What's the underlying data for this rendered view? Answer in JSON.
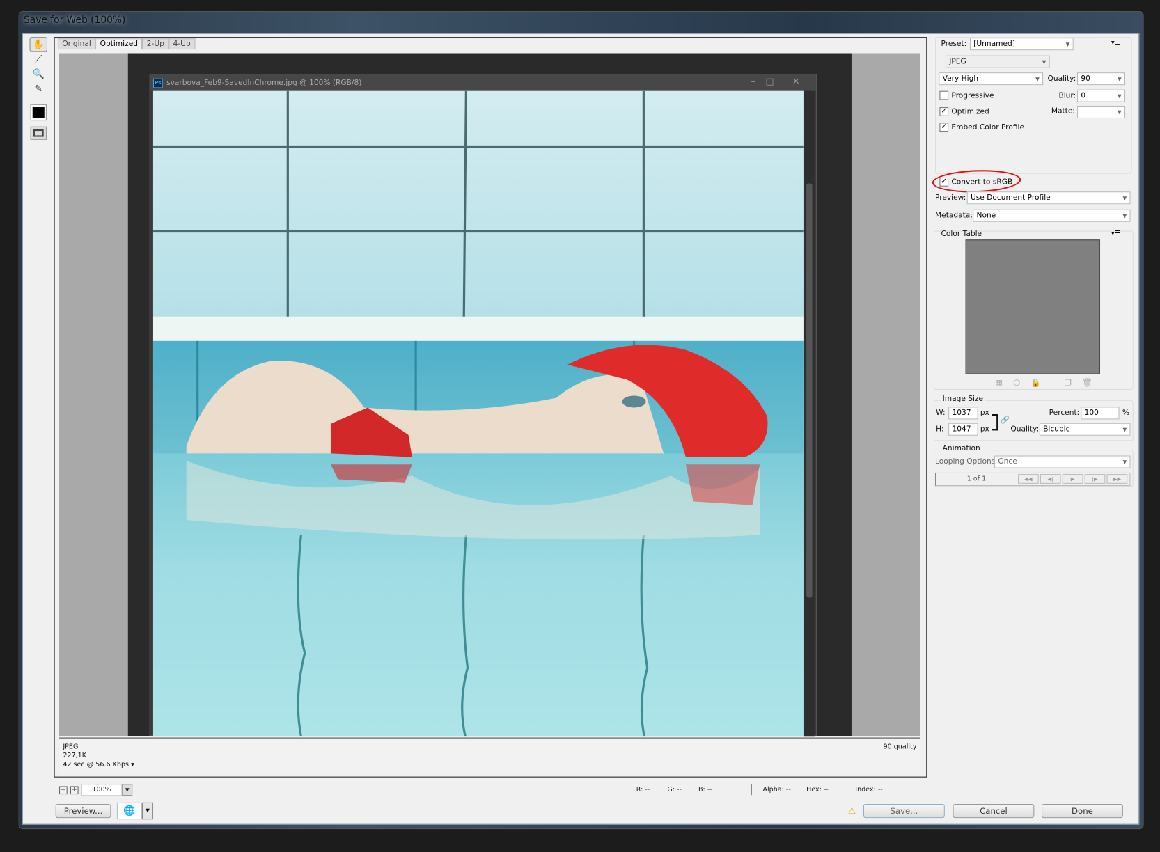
{
  "window": {
    "title": "Save for Web (100%)"
  },
  "tools": [
    {
      "name": "hand-tool",
      "glyph": "✋"
    },
    {
      "name": "slice-select-tool",
      "glyph": "⟋"
    },
    {
      "name": "zoom-tool",
      "glyph": "🔍"
    },
    {
      "name": "eyedropper-tool",
      "glyph": "✎"
    }
  ],
  "tabs": [
    {
      "label": "Original"
    },
    {
      "label": "Optimized",
      "active": true
    },
    {
      "label": "2-Up"
    },
    {
      "label": "4-Up"
    }
  ],
  "document": {
    "title": "svarbova_Feb9-SavedInChrome.jpg @ 100% (RGB/8)",
    "ps_badge": "Ps"
  },
  "status": {
    "format": "JPEG",
    "size": "227,1K",
    "time": "42 sec @ 56.6 Kbps",
    "quality": "90 quality"
  },
  "zoom": {
    "value": "100%"
  },
  "readout": {
    "r": "R: --",
    "g": "G: --",
    "b": "B: --",
    "alpha": "Alpha: --",
    "hex": "Hex: --",
    "index": "Index: --"
  },
  "buttons": {
    "preview": "Preview...",
    "save": "Save...",
    "cancel": "Cancel",
    "done": "Done"
  },
  "settings": {
    "preset_label": "Preset:",
    "preset": "[Unnamed]",
    "format": "JPEG",
    "compression": "Very High",
    "quality_label": "Quality:",
    "quality": "90",
    "progressive": {
      "label": "Progressive",
      "checked": false
    },
    "blur_label": "Blur:",
    "blur": "0",
    "optimized": {
      "label": "Optimized",
      "checked": true
    },
    "matte_label": "Matte:",
    "matte": "",
    "embed": {
      "label": "Embed Color Profile",
      "checked": true
    },
    "srgb": {
      "label": "Convert to sRGB",
      "checked": true
    },
    "preview_label": "Preview:",
    "preview": "Use Document Profile",
    "metadata_label": "Metadata:",
    "metadata": "None",
    "annotation_color": "#e01010"
  },
  "color_table": {
    "title": "Color Table"
  },
  "image_size": {
    "title": "Image Size",
    "w_label": "W:",
    "w": "1037",
    "h_label": "H:",
    "h": "1047",
    "unit": "px",
    "percent_label": "Percent:",
    "percent": "100",
    "percent_unit": "%",
    "quality_label": "Quality:",
    "quality": "Bicubic"
  },
  "animation": {
    "title": "Animation",
    "looping_label": "Looping Options:",
    "looping": "Once",
    "frame": "1 of 1"
  }
}
